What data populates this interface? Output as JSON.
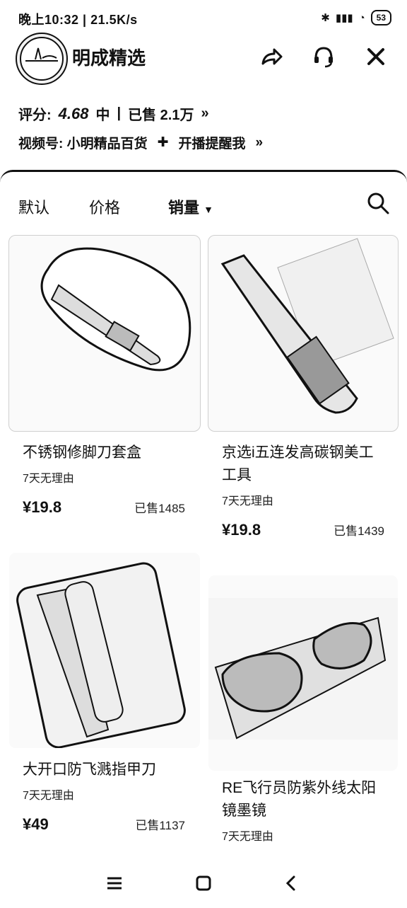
{
  "status_bar": {
    "time": "晚上10:32",
    "speed": "21.5K/s",
    "battery": "53"
  },
  "header": {
    "shop_name": "明成精选"
  },
  "rating": {
    "label": "评分:",
    "score": "4.68",
    "level": "中",
    "sold": "已售 2.1万"
  },
  "video": {
    "channel": "视频号: 小明精品百货",
    "remind": "开播提醒我"
  },
  "filters": {
    "default": "默认",
    "price": "价格",
    "sales": "销量"
  },
  "products": [
    {
      "title": "不锈钢修脚刀套盒",
      "tag": "7天无理由",
      "price": "¥19.8",
      "sold": "已售1485"
    },
    {
      "title": "京选i五连发高碳钢美工工具",
      "tag": "7天无理由",
      "price": "¥19.8",
      "sold": "已售1439"
    },
    {
      "title": "大开口防飞溅指甲刀",
      "tag": "7天无理由",
      "price": "¥49",
      "sold": "已售1137"
    },
    {
      "title": "RE飞行员防紫外线太阳镜墨镜",
      "tag": "7天无理由",
      "price": "",
      "sold": ""
    }
  ]
}
